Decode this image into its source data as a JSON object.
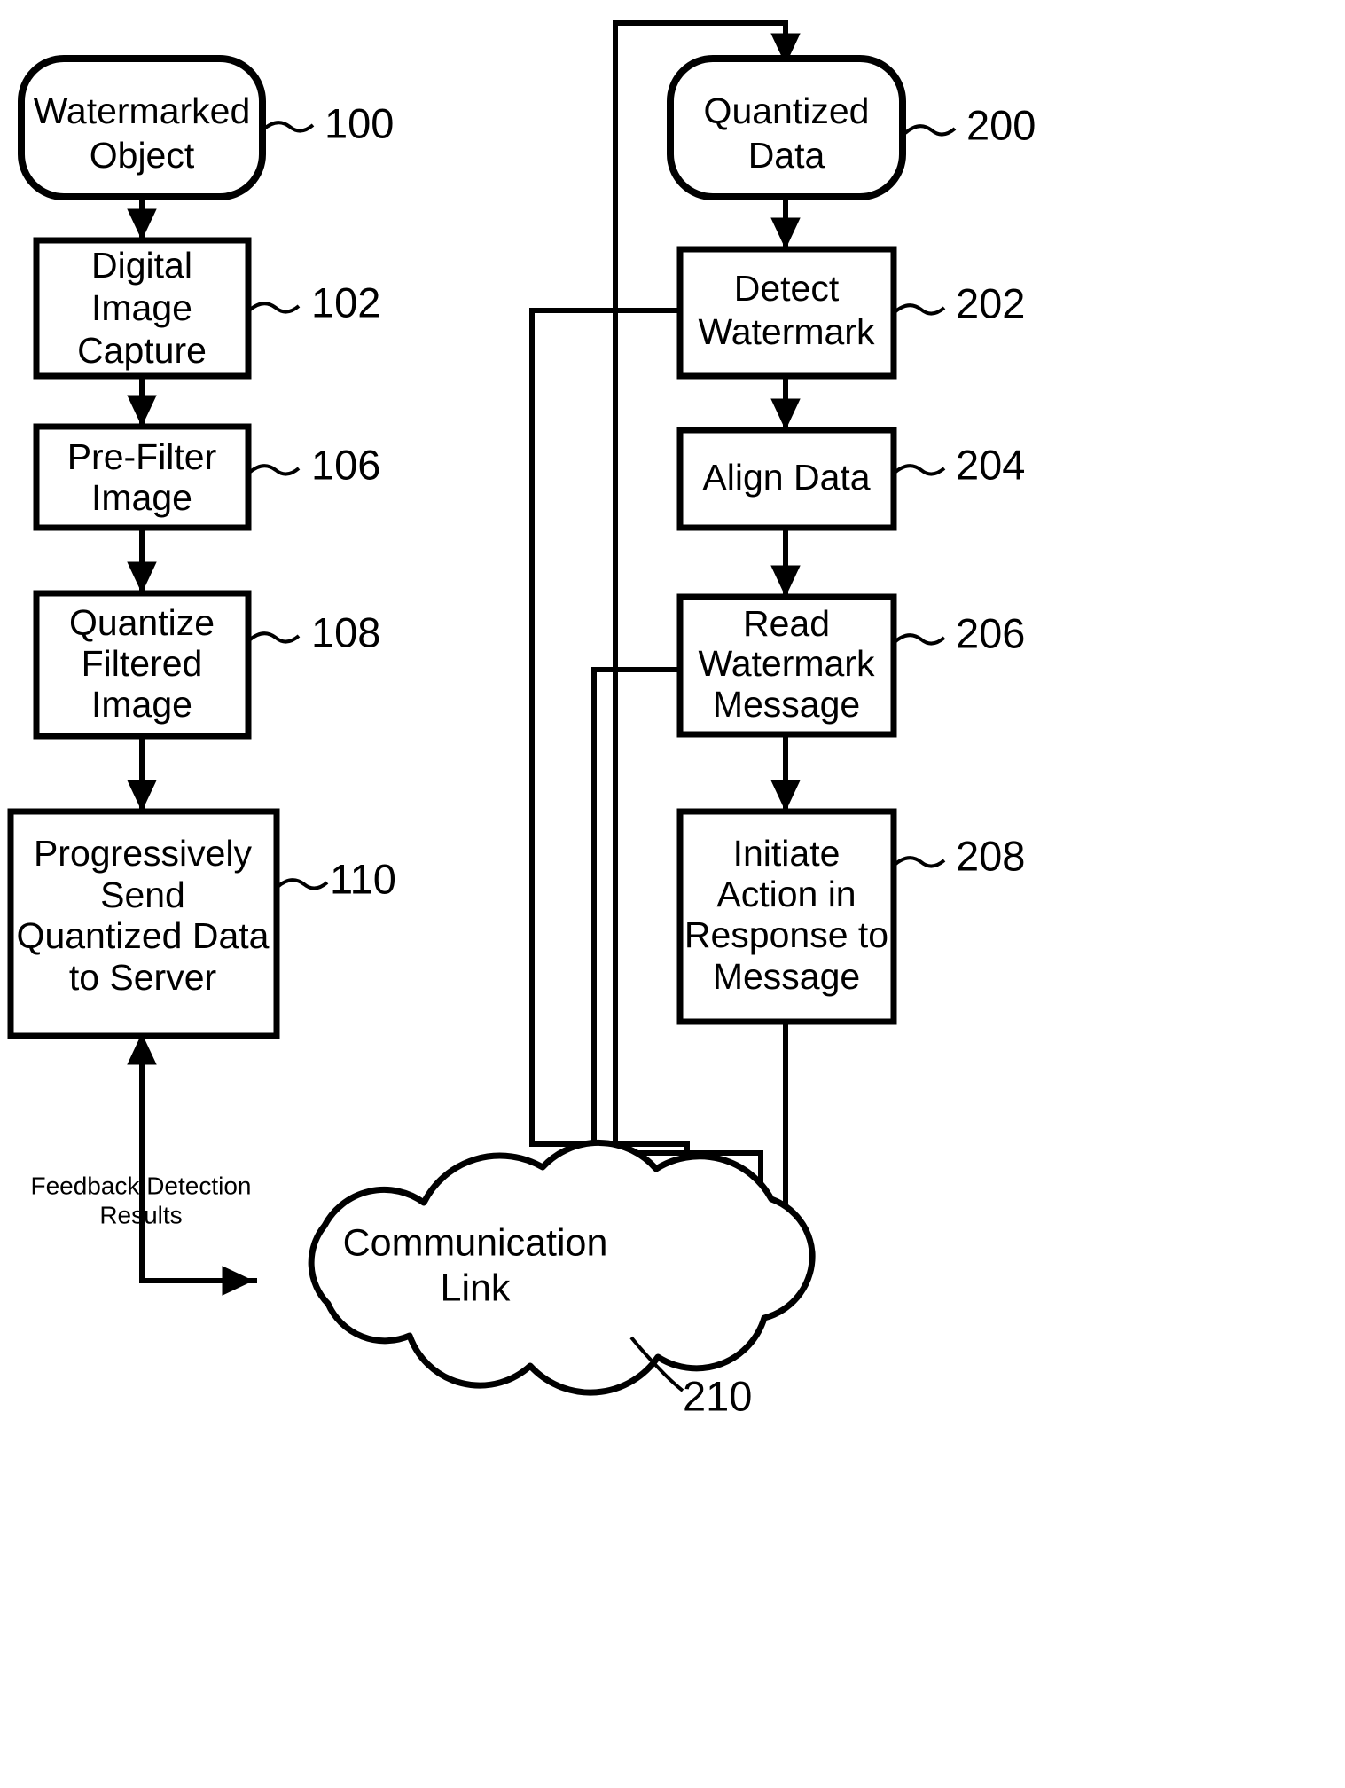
{
  "figure": {
    "title": "Watermark detection and feedback flowchart",
    "line_color": "#000000",
    "background_color": "#ffffff"
  },
  "nodes": {
    "watermarked_object": {
      "ref": "100",
      "shape": "rounded",
      "lines": [
        "Watermarked",
        "Object"
      ]
    },
    "digital_image_capture": {
      "ref": "102",
      "shape": "rect",
      "lines": [
        "Digital",
        "Image",
        "Capture"
      ]
    },
    "pre_filter_image": {
      "ref": "106",
      "shape": "rect",
      "lines": [
        "Pre-Filter",
        "Image"
      ]
    },
    "quantize_filtered_image": {
      "ref": "108",
      "shape": "rect",
      "lines": [
        "Quantize",
        "Filtered",
        "Image"
      ]
    },
    "progressively_send": {
      "ref": "110",
      "shape": "rect",
      "lines": [
        "Progressively",
        "Send",
        "Quantized Data",
        "to Server"
      ]
    },
    "quantized_data": {
      "ref": "200",
      "shape": "rounded",
      "lines": [
        "Quantized",
        "Data"
      ]
    },
    "detect_watermark": {
      "ref": "202",
      "shape": "rect",
      "lines": [
        "Detect",
        "Watermark"
      ]
    },
    "align_data": {
      "ref": "204",
      "shape": "rect",
      "lines": [
        "Align Data"
      ]
    },
    "read_watermark_message": {
      "ref": "206",
      "shape": "rect",
      "lines": [
        "Read",
        "Watermark",
        "Message"
      ]
    },
    "initiate_action": {
      "ref": "208",
      "shape": "rect",
      "lines": [
        "Initiate",
        "Action in",
        "Response to",
        "Message"
      ]
    },
    "communication_link": {
      "ref": "210",
      "shape": "cloud",
      "lines": [
        "Communication",
        "Link"
      ]
    }
  },
  "annotations": {
    "feedback": {
      "lines": [
        "Feedback Detection",
        "Results"
      ]
    }
  }
}
